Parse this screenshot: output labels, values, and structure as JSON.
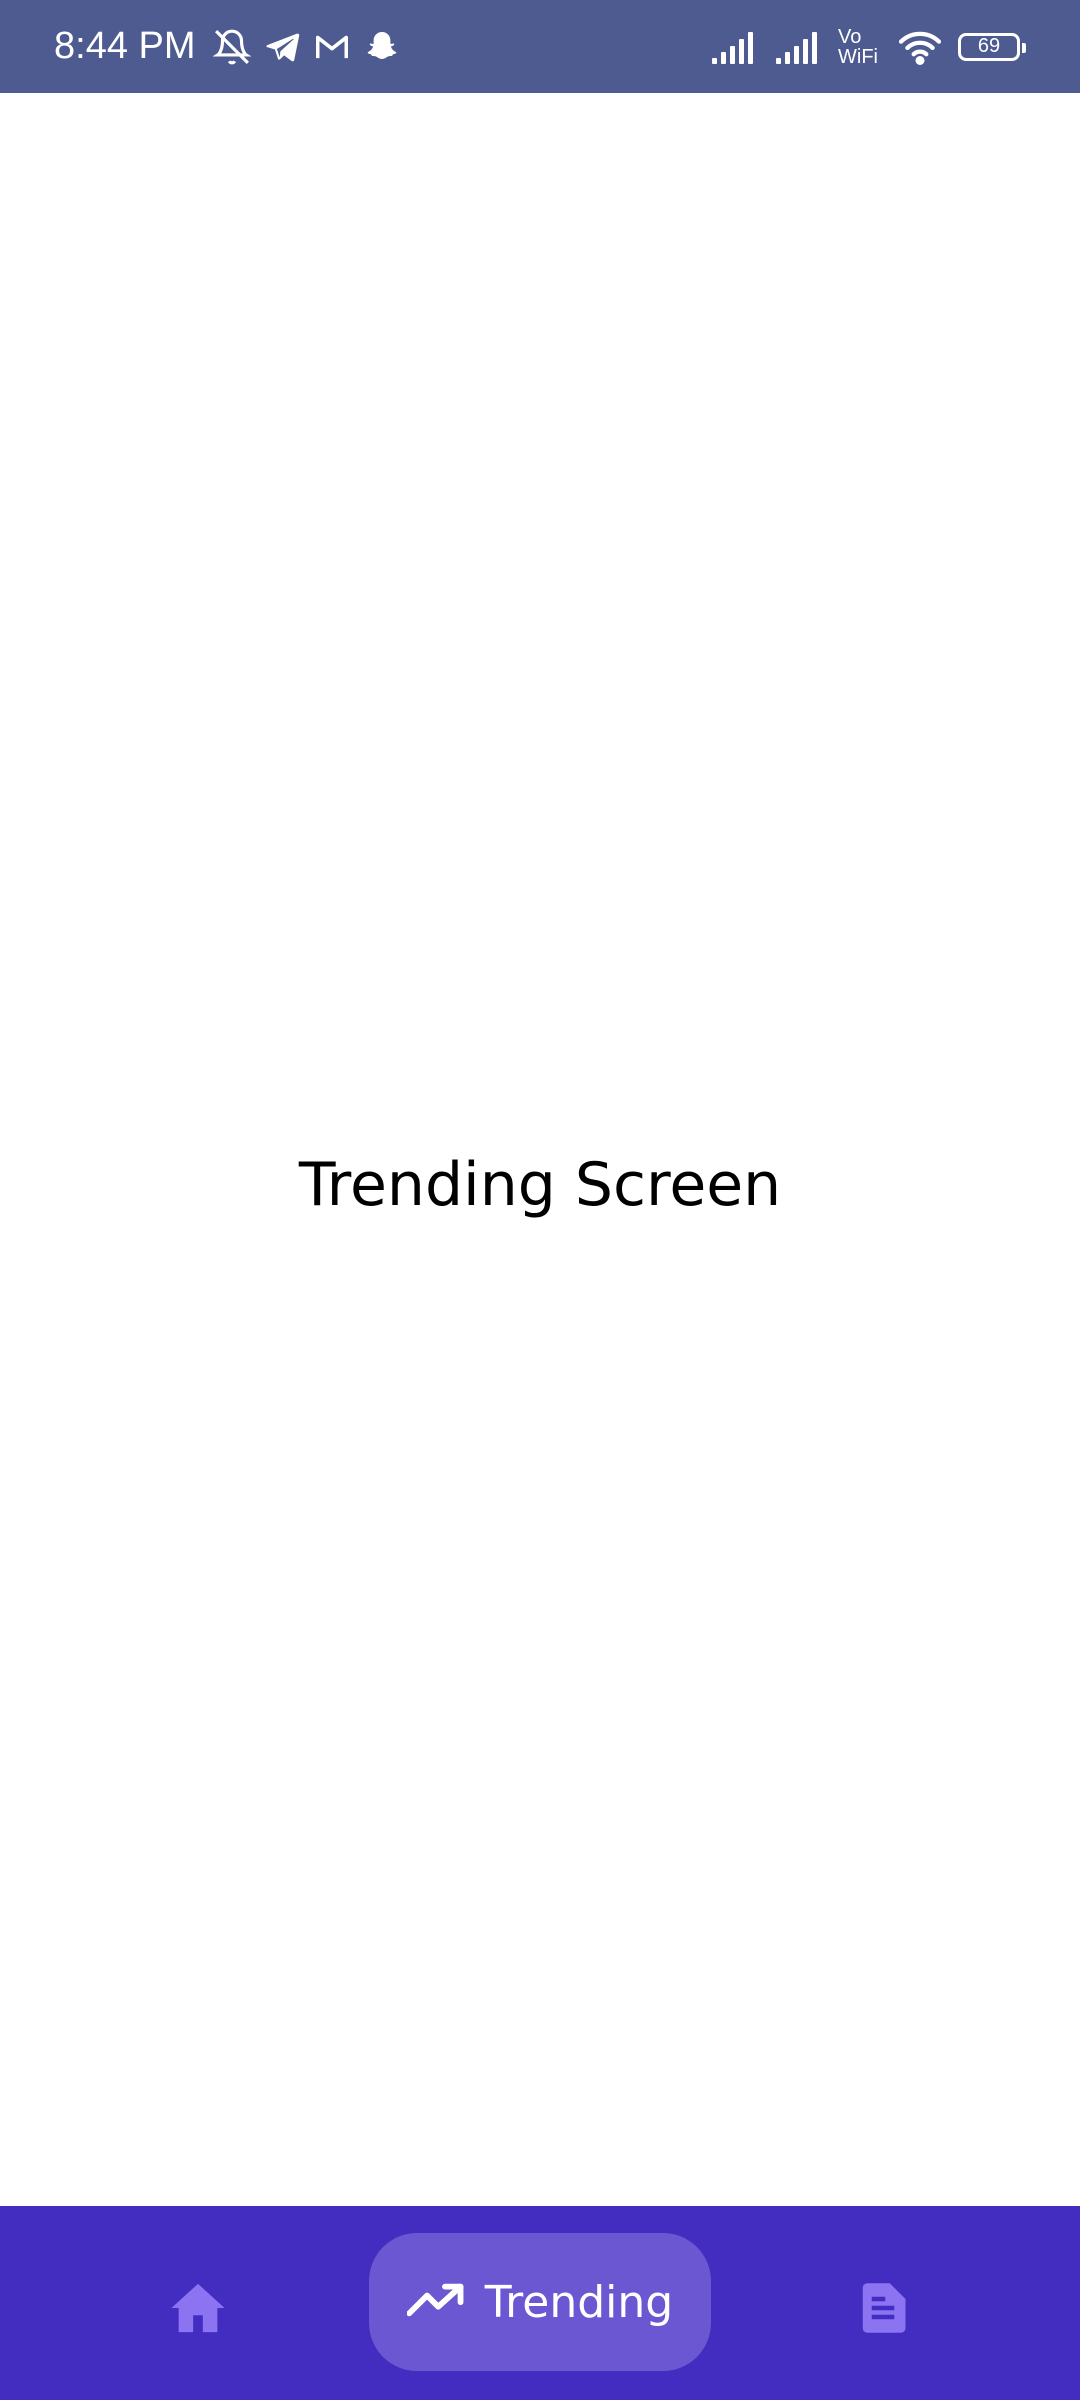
{
  "status_bar": {
    "time": "8:44 PM",
    "left_icons": [
      "bell-off-icon",
      "telegram-icon",
      "gmail-icon",
      "snapchat-icon"
    ],
    "network_label_top": "Vo",
    "network_label_bottom": "WiFi",
    "battery": "69",
    "background": "#4e5b91"
  },
  "main": {
    "title": "Trending Screen"
  },
  "bottom_nav": {
    "background": "#432dc1",
    "active_pill": "#6a57d1",
    "inactive_icon_color": "#8b73f2",
    "items": [
      {
        "icon": "home-icon",
        "label": ""
      },
      {
        "icon": "trending-up-icon",
        "label": "Trending"
      },
      {
        "icon": "document-icon",
        "label": ""
      }
    ]
  }
}
